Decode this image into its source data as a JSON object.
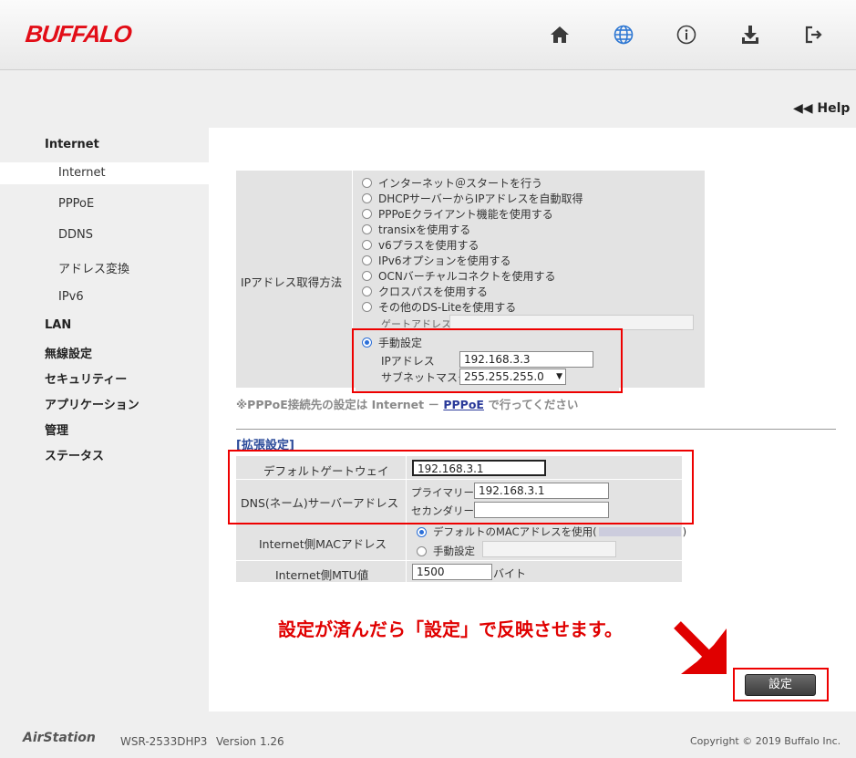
{
  "brand": {
    "logo": "BUFFALO"
  },
  "header_icons": [
    "home-icon",
    "globe-icon",
    "info-icon",
    "download-icon",
    "logout-icon"
  ],
  "help": {
    "label": "Help"
  },
  "nav": {
    "sections": [
      "Internet",
      "LAN",
      "無線設定",
      "セキュリティー",
      "アプリケーション",
      "管理",
      "ステータス"
    ],
    "internet_items": [
      "Internet",
      "PPPoE",
      "DDNS",
      "アドレス変換",
      "IPv6"
    ]
  },
  "ip_method": {
    "label": "IPアドレス取得方法",
    "options": [
      "インターネット＠スタートを行う",
      "DHCPサーバーからIPアドレスを自動取得",
      "PPPoEクライアント機能を使用する",
      "transixを使用する",
      "v6プラスを使用する",
      "IPv6オプションを使用する",
      "OCNバーチャルコネクトを使用する",
      "クロスパスを使用する",
      "その他のDS-Liteを使用する"
    ],
    "gateway_label": "ゲートアドレス",
    "manual_label": "手動設定",
    "ip_label": "IPアドレス",
    "ip_value": "192.168.3.3",
    "subnet_label": "サブネットマスク",
    "subnet_value": "255.255.255.0"
  },
  "note": {
    "prefix": "※PPPoE接続先の設定は Internet － ",
    "link": "PPPoE",
    "suffix": " で行ってください"
  },
  "advanced": {
    "title": "[拡張設定]",
    "gateway_label": "デフォルトゲートウェイ",
    "gateway_value": "192.168.3.1",
    "dns_label": "DNS(ネーム)サーバーアドレス",
    "primary_label": "プライマリー:",
    "primary_value": "192.168.3.1",
    "secondary_label": "セカンダリー:",
    "secondary_value": "",
    "mac_label": "Internet側MACアドレス",
    "mac_default": "デフォルトのMACアドレスを使用(",
    "mac_default_end": ")",
    "mac_manual": "手動設定",
    "mtu_label": "Internet側MTU値",
    "mtu_value": "1500",
    "mtu_unit": "バイト"
  },
  "annotation": {
    "text": "設定が済んだら「設定」で反映させます。",
    "color": "#e00000"
  },
  "submit": {
    "label": "設定"
  },
  "footer": {
    "product": "AirStation",
    "model": "WSR-2533DHP3",
    "version": "Version 1.26",
    "copyright": "Copyright © 2019 Buffalo Inc."
  }
}
